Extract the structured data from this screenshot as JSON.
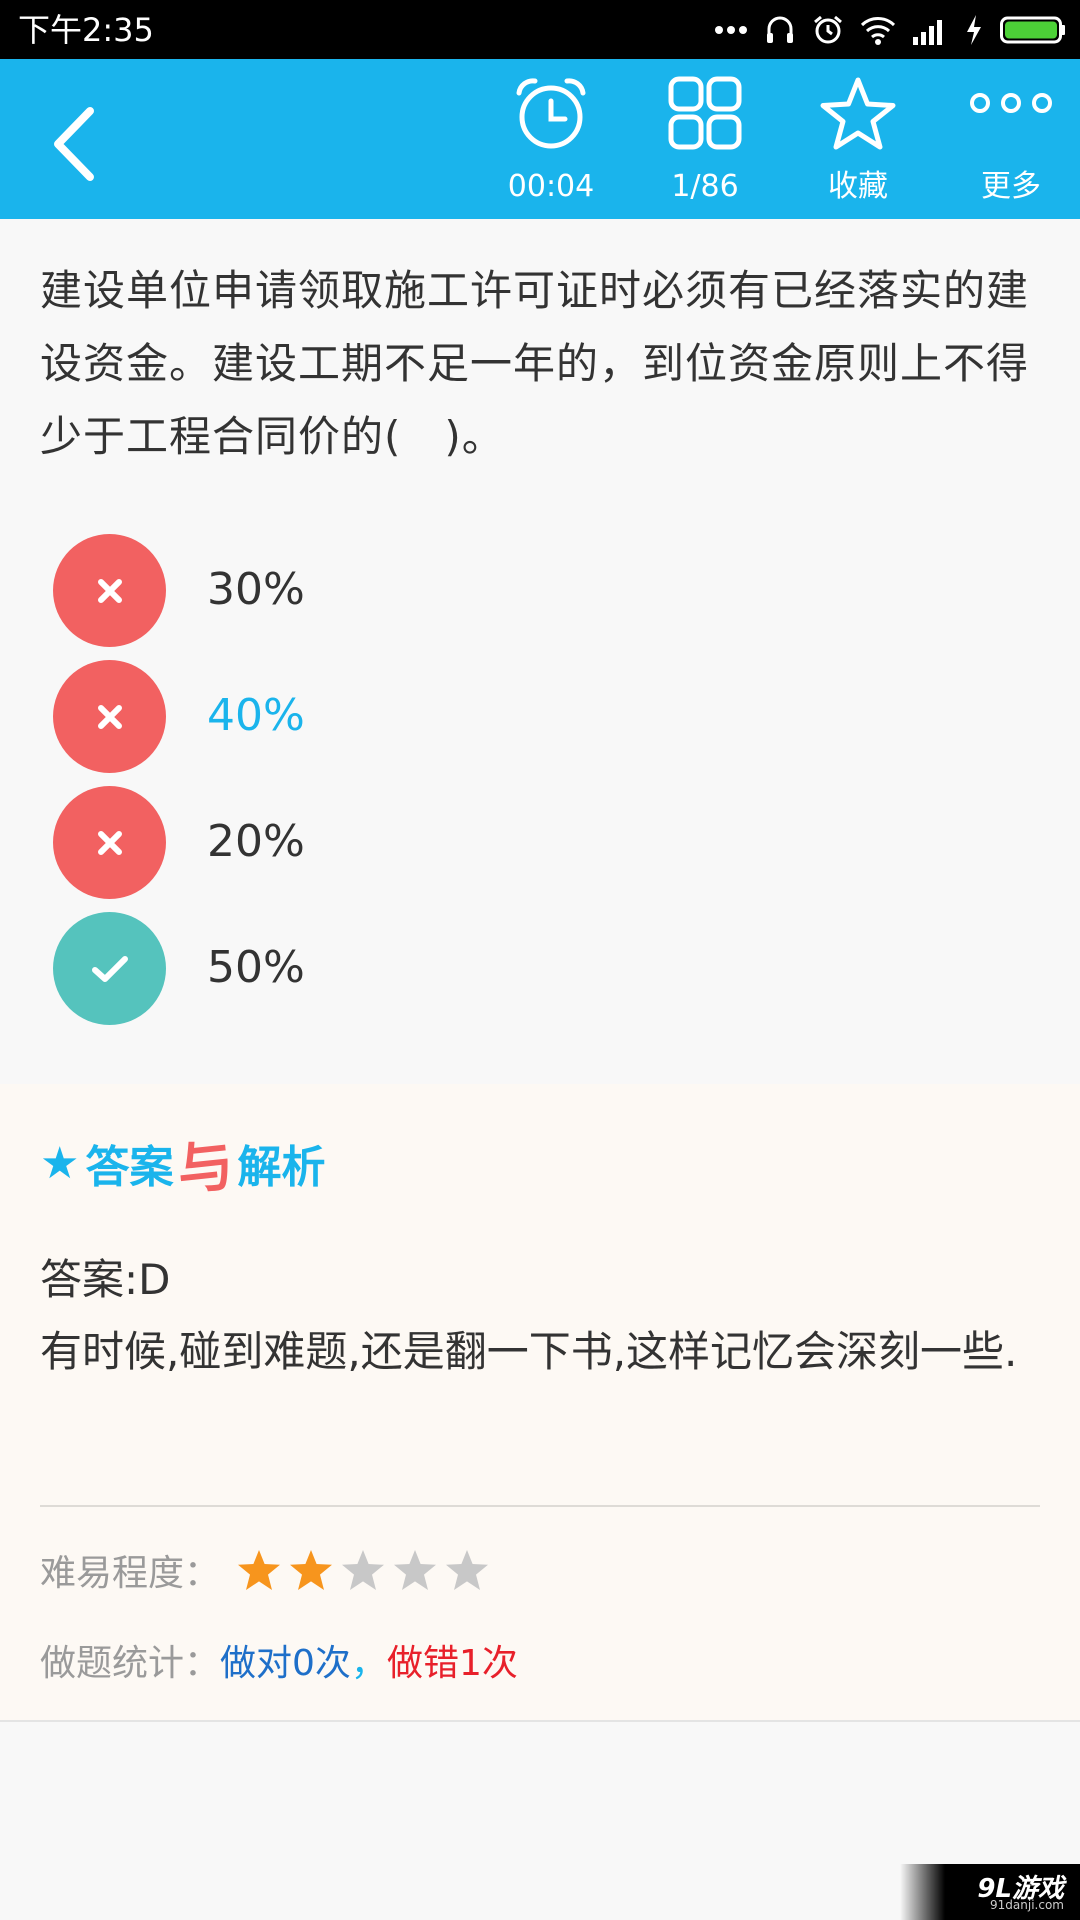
{
  "status_bar": {
    "time": "下午2:35"
  },
  "toolbar": {
    "timer_label": "00:04",
    "index_label": "1/86",
    "favorite_label": "收藏",
    "more_label": "更多"
  },
  "question": {
    "text": "建设单位申请领取施工许可证时必须有已经落实的建设资金。建设工期不足一年的，到位资金原则上不得少于工程合同价的(　)。",
    "options": [
      {
        "label": "30%",
        "state": "wrong"
      },
      {
        "label": "40%",
        "state": "wrong-selected"
      },
      {
        "label": "20%",
        "state": "wrong"
      },
      {
        "label": "50%",
        "state": "correct"
      }
    ]
  },
  "analysis": {
    "heading_part1": "答案",
    "heading_part2": "与",
    "heading_part3": "解析",
    "answer": "答案:D",
    "explanation": "有时候,碰到难题,还是翻一下书,这样记忆会深刻一些.",
    "difficulty_label": "难易程度：",
    "difficulty_stars": 2,
    "difficulty_max": 5,
    "stats_label": "做题统计：",
    "stats_right": "做对0次",
    "stats_sep": "，",
    "stats_wrong": "做错1次"
  },
  "watermark": {
    "text": "9L游戏",
    "sub": "91danji.com"
  },
  "colors": {
    "accent": "#1ab4ec",
    "wrong": "#f26161",
    "correct": "#55c3bd",
    "star_on": "#f7951d",
    "star_off": "#c8c8c8"
  }
}
